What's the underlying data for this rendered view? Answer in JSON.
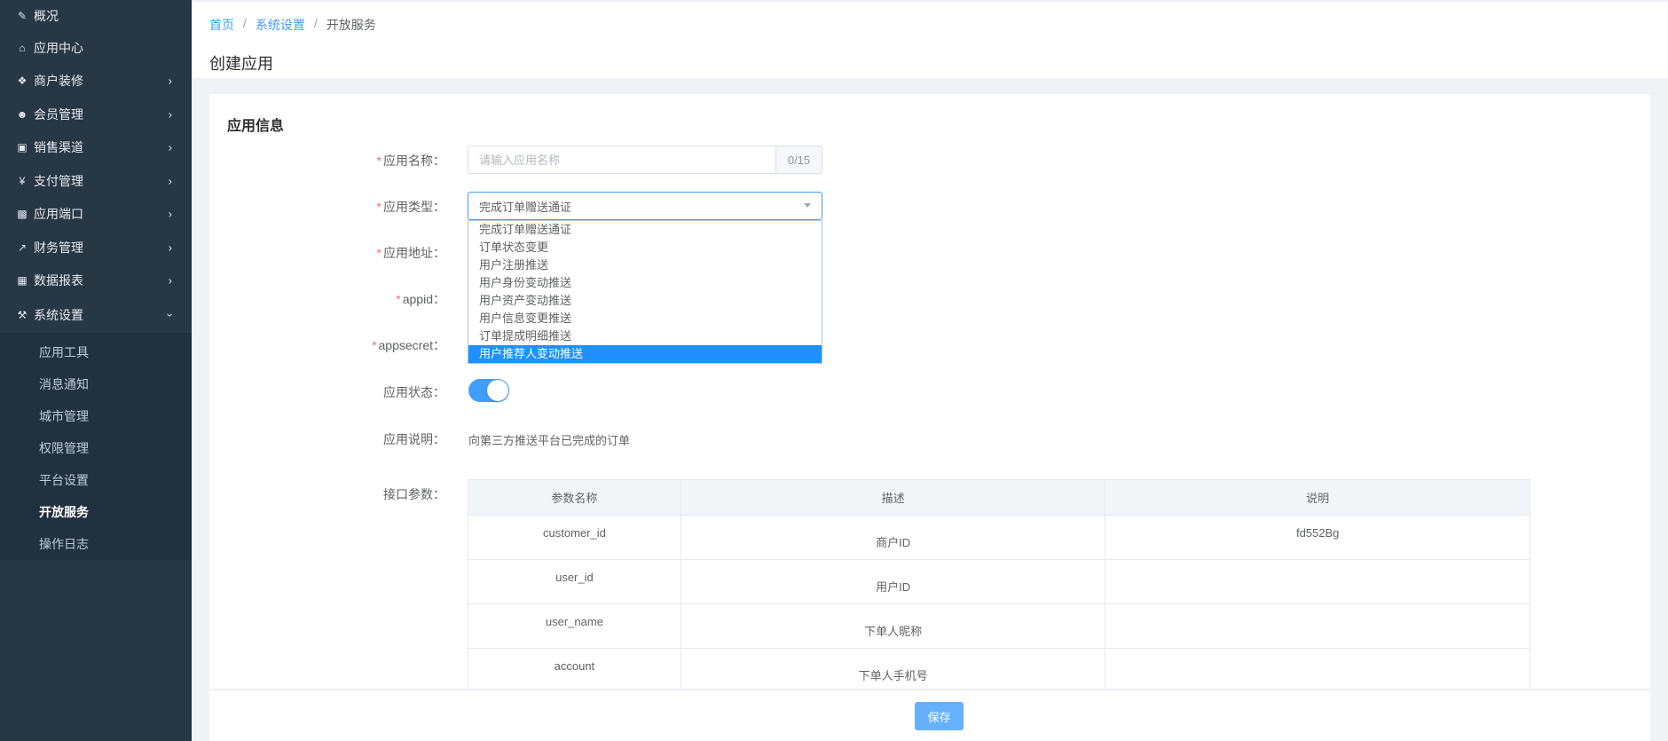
{
  "sidebar": {
    "items": [
      {
        "label": "概况",
        "icon": "edit-icon",
        "has_children": false
      },
      {
        "label": "应用中心",
        "icon": "home-icon",
        "has_children": false
      },
      {
        "label": "商户装修",
        "icon": "cubes-icon",
        "has_children": true
      },
      {
        "label": "会员管理",
        "icon": "users-icon",
        "has_children": true
      },
      {
        "label": "销售渠道",
        "icon": "money-icon",
        "has_children": true
      },
      {
        "label": "支付管理",
        "icon": "yen-icon",
        "has_children": true
      },
      {
        "label": "应用端口",
        "icon": "puzzle-icon",
        "has_children": true
      },
      {
        "label": "财务管理",
        "icon": "line-chart-icon",
        "has_children": true
      },
      {
        "label": "数据报表",
        "icon": "report-icon",
        "has_children": true
      },
      {
        "label": "系统设置",
        "icon": "gavel-icon",
        "has_children": true,
        "expanded": true
      }
    ],
    "sub_items": [
      {
        "label": "应用工具",
        "active": false
      },
      {
        "label": "消息通知",
        "active": false
      },
      {
        "label": "城市管理",
        "active": false
      },
      {
        "label": "权限管理",
        "active": false
      },
      {
        "label": "平台设置",
        "active": false
      },
      {
        "label": "开放服务",
        "active": true
      },
      {
        "label": "操作日志",
        "active": false
      }
    ]
  },
  "breadcrumb": {
    "items": [
      "首页",
      "系统设置",
      "开放服务"
    ],
    "separator": "/"
  },
  "page_title": "创建应用",
  "form": {
    "section_title": "应用信息",
    "required_mark": "*",
    "labels": {
      "name": "应用名称：",
      "type": "应用类型：",
      "address": "应用地址：",
      "appid": "appid：",
      "appsecret": "appsecret：",
      "status": "应用状态：",
      "description": "应用说明：",
      "params": "接口参数："
    },
    "name_input": {
      "value": "",
      "placeholder": "请输入应用名称",
      "counter": "0/15"
    },
    "type_select": {
      "value": "完成订单赠送通证",
      "options": [
        "完成订单赠送通证",
        "订单状态变更",
        "用户注册推送",
        "用户身份变动推送",
        "用户资产变动推送",
        "用户信息变更推送",
        "订单提成明细推送",
        "用户推荐人变动推送"
      ],
      "highlighted": "用户推荐人变动推送"
    },
    "status_on": true,
    "description_text": "向第三方推送平台已完成的订单"
  },
  "params_table": {
    "headers": [
      "参数名称",
      "描述",
      "说明"
    ],
    "rows": [
      [
        "customer_id",
        "商户ID",
        "fd552Bg"
      ],
      [
        "user_id",
        "用户ID",
        ""
      ],
      [
        "user_name",
        "下单人昵称",
        ""
      ],
      [
        "account",
        "下单人手机号",
        ""
      ]
    ]
  },
  "footer": {
    "save_label": "保存"
  },
  "colors": {
    "sidebar_bg": "#283744",
    "primary": "#409eff",
    "highlight": "#1e90ff",
    "required": "#f56c6c"
  }
}
